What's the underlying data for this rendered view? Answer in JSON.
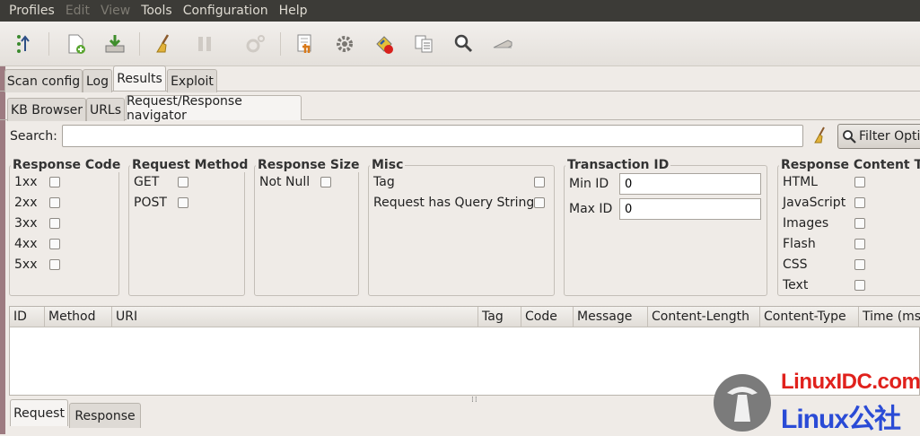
{
  "menu": [
    "Profiles",
    "Edit",
    "View",
    "Tools",
    "Configuration",
    "Help"
  ],
  "toolbar_icons": [
    "wizard-icon",
    "new-profile-icon",
    "save-profile-icon",
    "clear-icon",
    "pause-icon",
    "settings-disabled-icon",
    "manual-request-icon",
    "config-gear-icon",
    "exploit-icon",
    "compare-icon",
    "search-icon",
    "proxy-icon"
  ],
  "tabs_main": [
    "Scan config",
    "Log",
    "Results",
    "Exploit"
  ],
  "tabs_results": [
    "KB Browser",
    "URLs",
    "Request/Response navigator"
  ],
  "search": {
    "label": "Search:",
    "value": "",
    "filter_button": "Filter Optio"
  },
  "filters": {
    "response_code": {
      "title": "Response Code",
      "items": [
        "1xx",
        "2xx",
        "3xx",
        "4xx",
        "5xx"
      ]
    },
    "request_method": {
      "title": "Request Method",
      "items": [
        "GET",
        "POST"
      ]
    },
    "response_size": {
      "title": "Response Size",
      "items": [
        "Not Null"
      ]
    },
    "misc": {
      "title": "Misc",
      "items": [
        "Tag",
        "Request has Query String"
      ]
    },
    "transaction_id": {
      "title": "Transaction ID",
      "min_label": "Min ID",
      "min_value": "0",
      "max_label": "Max ID",
      "max_value": "0"
    },
    "content_type": {
      "title": "Response Content Ty",
      "items": [
        "HTML",
        "JavaScript",
        "Images",
        "Flash",
        "CSS",
        "Text"
      ]
    }
  },
  "table": {
    "columns": [
      "ID",
      "Method",
      "URI",
      "Tag",
      "Code",
      "Message",
      "Content-Length",
      "Content-Type",
      "Time (ms)"
    ]
  },
  "bottom_tabs": [
    "Request",
    "Response"
  ],
  "watermark": {
    "line1": "LinuxIDC.com",
    "line2": "Linux公社"
  }
}
